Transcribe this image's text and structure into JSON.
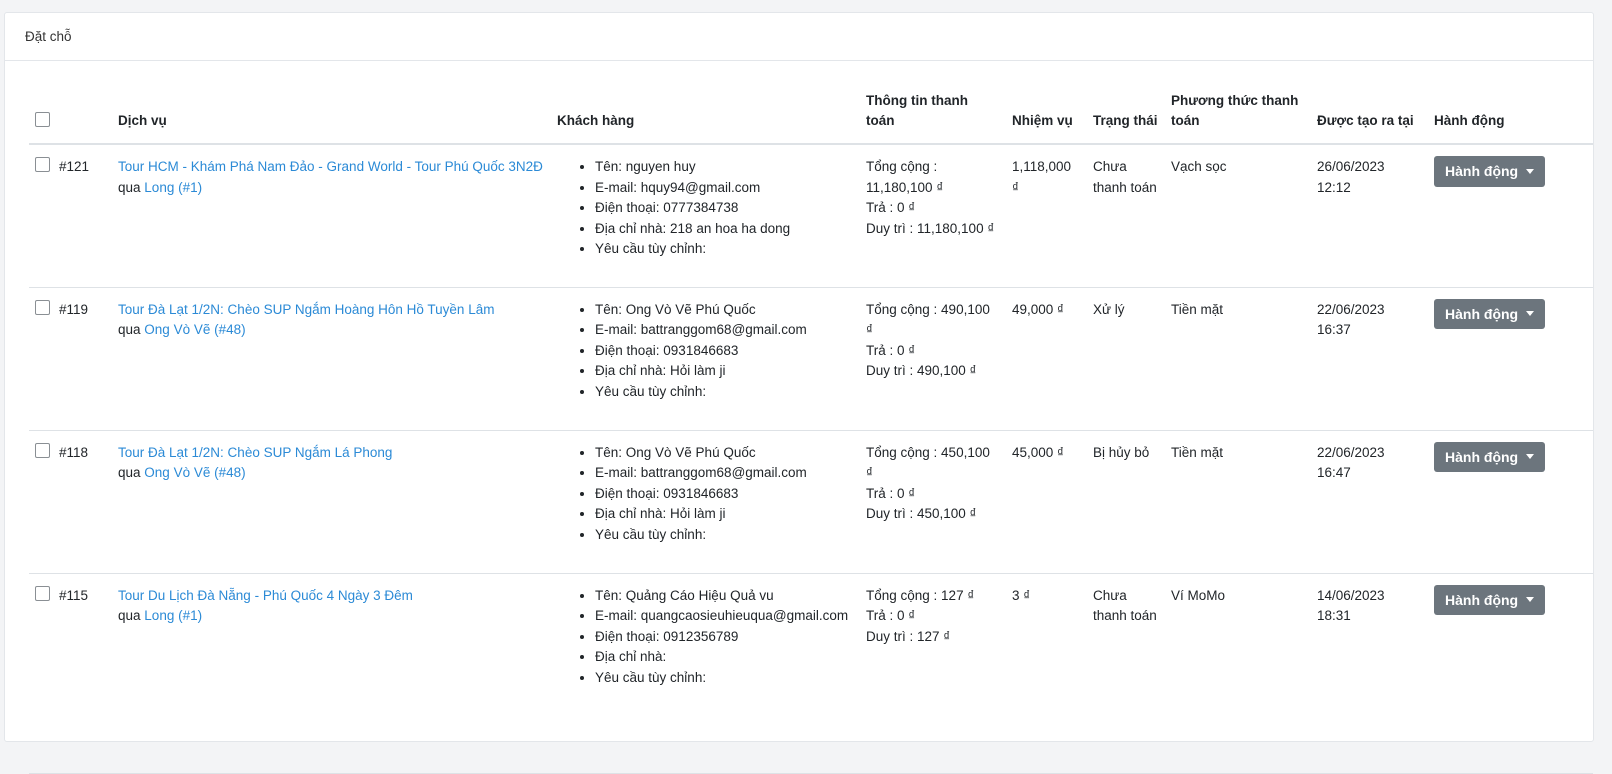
{
  "header": {
    "title": "Đặt chỗ"
  },
  "columns": {
    "service": "Dịch vụ",
    "customer": "Khách hàng",
    "payment_info": "Thông tin thanh toán",
    "commission": "Nhiệm vụ",
    "status": "Trạng thái",
    "payment_method": "Phương thức thanh toán",
    "created_at": "Được tạo ra tại",
    "action": "Hành động"
  },
  "rows": [
    {
      "id": "#121",
      "service": "Tour HCM - Khám Phá Nam Đảo - Grand World - Tour Phú Quốc 3N2Đ",
      "via_prefix": "qua",
      "via": "Long (#1)",
      "name": "Tên: nguyen huy",
      "email": "E-mail: hquy94@gmail.com",
      "phone": "Điện thoại: 0777384738",
      "address": "Địa chỉ nhà: 218 an hoa ha dong",
      "custom": "Yêu cầu tùy chỉnh:",
      "total": "Tổng cộng : 11,180,100 ₫",
      "paid": "Trả : 0 ₫",
      "remain": "Duy trì : 11,180,100 ₫",
      "commission": "1,118,000 ₫",
      "status": "Chưa thanh toán",
      "method": "Vạch sọc",
      "date": "26/06/2023",
      "time": "12:12",
      "action": "Hành động"
    },
    {
      "id": "#119",
      "service": "Tour Đà Lạt 1/2N: Chèo SUP Ngắm Hoàng Hôn Hồ Tuyền Lâm",
      "via_prefix": "qua",
      "via": "Ong Vò Vẽ (#48)",
      "name": "Tên: Ong Vò Vẽ Phú Quốc",
      "email": "E-mail: battranggom68@gmail.com",
      "phone": "Điện thoại: 0931846683",
      "address": "Địa chỉ nhà: Hỏi làm ji",
      "custom": "Yêu cầu tùy chỉnh:",
      "total": "Tổng cộng : 490,100 ₫",
      "paid": "Trả : 0 ₫",
      "remain": "Duy trì : 490,100 ₫",
      "commission": "49,000 ₫",
      "status": "Xử lý",
      "method": "Tiền mặt",
      "date": "22/06/2023",
      "time": "16:37",
      "action": "Hành động"
    },
    {
      "id": "#118",
      "service": "Tour Đà Lạt 1/2N: Chèo SUP Ngắm Lá Phong",
      "via_prefix": "qua",
      "via": "Ong Vò Vẽ (#48)",
      "name": "Tên: Ong Vò Vẽ Phú Quốc",
      "email": "E-mail: battranggom68@gmail.com",
      "phone": "Điện thoại: 0931846683",
      "address": "Địa chỉ nhà: Hỏi làm ji",
      "custom": "Yêu cầu tùy chỉnh:",
      "total": "Tổng cộng : 450,100 ₫",
      "paid": "Trả : 0 ₫",
      "remain": "Duy trì : 450,100 ₫",
      "commission": "45,000 ₫",
      "status": "Bị hủy bỏ",
      "method": "Tiền mặt",
      "date": "22/06/2023",
      "time": "16:47",
      "action": "Hành động"
    },
    {
      "id": "#115",
      "service": "Tour Du Lịch Đà Nẵng - Phú Quốc 4 Ngày 3 Đêm",
      "via_prefix": "qua",
      "via": "Long (#1)",
      "name": "Tên: Quảng Cáo Hiệu Quả vu",
      "email": "E-mail: quangcaosieuhieuqua@gmail.com",
      "phone": "Điện thoại: 0912356789",
      "address": "Địa chỉ nhà:",
      "custom": "Yêu cầu tùy chỉnh:",
      "total": "Tổng cộng : 127 ₫",
      "paid": "Trả : 0 ₫",
      "remain": "Duy trì : 127 ₫",
      "commission": "3 ₫",
      "status": "Chưa thanh toán",
      "method": "Ví MoMo",
      "date": "14/06/2023",
      "time": "18:31",
      "action": "Hành động"
    }
  ]
}
